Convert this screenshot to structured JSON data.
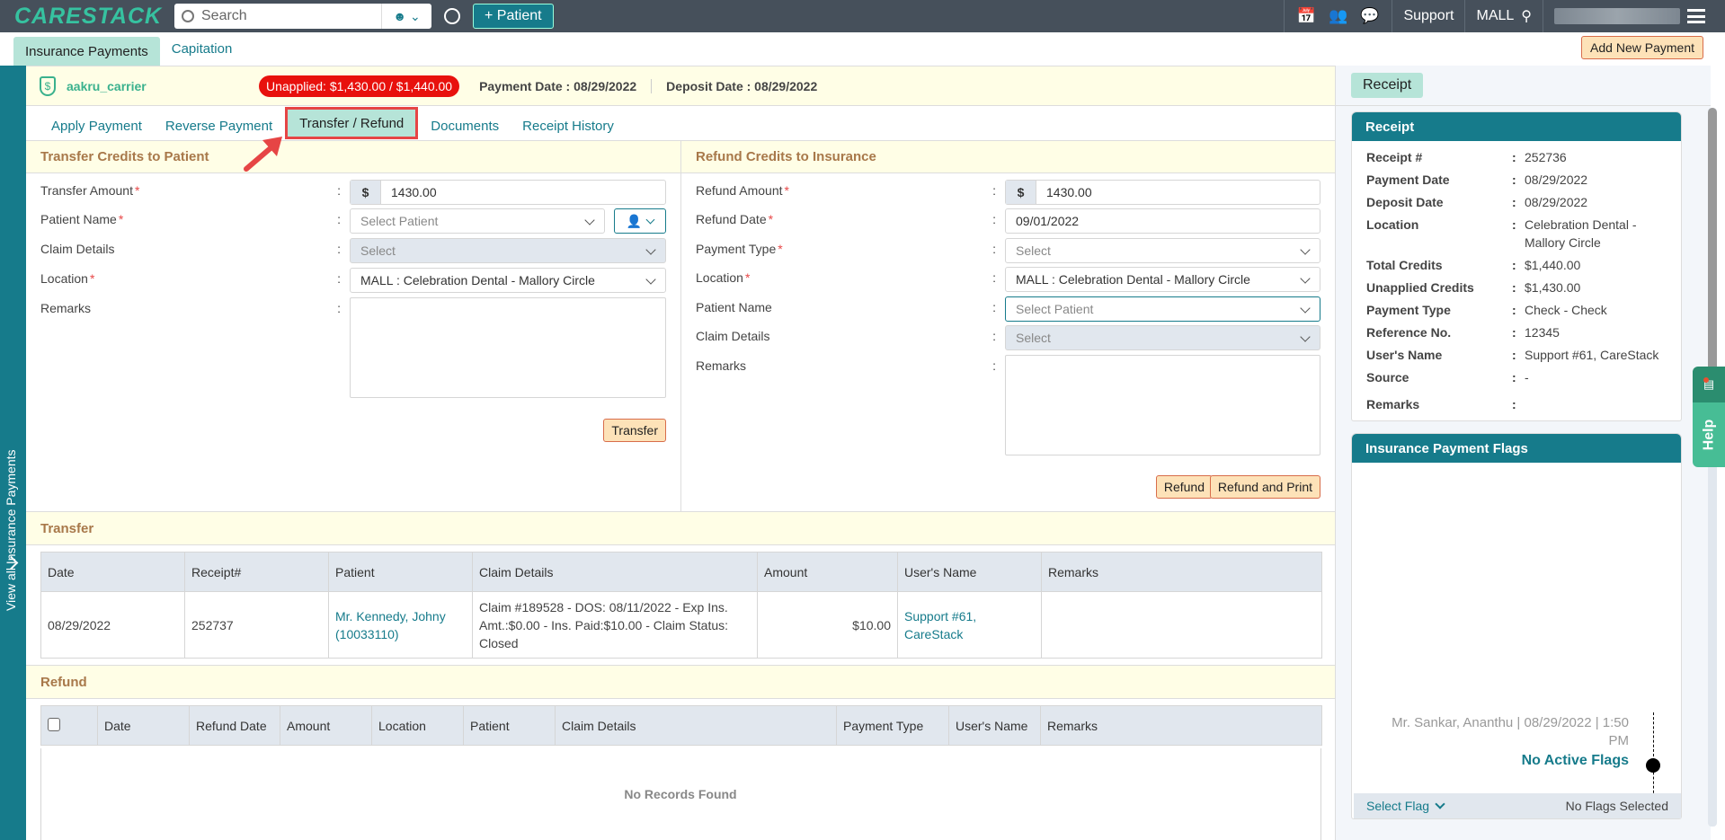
{
  "topbar": {
    "logo": "CARESTACK",
    "search_placeholder": "Search",
    "add_patient_label": "+ Patient",
    "support_label": "Support",
    "location_label": "MALL"
  },
  "subnav": {
    "tabs": [
      {
        "label": "Insurance Payments",
        "active": true
      },
      {
        "label": "Capitation",
        "active": false
      }
    ],
    "add_new_payment_label": "Add New Payment"
  },
  "sidebar": {
    "view_all_label": "View all Insurance Payments"
  },
  "payment_header": {
    "carrier": "aakru_carrier",
    "unapplied_badge": "Unapplied: $1,430.00 / $1,440.00",
    "payment_date": "Payment Date : 08/29/2022",
    "deposit_date": "Deposit Date : 08/29/2022"
  },
  "tabs": [
    {
      "label": "Apply Payment",
      "active": false
    },
    {
      "label": "Reverse Payment",
      "active": false
    },
    {
      "label": "Transfer / Refund",
      "active": true
    },
    {
      "label": "Documents",
      "active": false
    },
    {
      "label": "Receipt History",
      "active": false
    }
  ],
  "transfer_form": {
    "title": "Transfer Credits to Patient",
    "transfer_amount_label": "Transfer Amount",
    "currency_symbol": "$",
    "transfer_amount_value": "1430.00",
    "patient_name_label": "Patient Name",
    "patient_placeholder": "Select Patient",
    "claim_details_label": "Claim Details",
    "claim_placeholder": "Select",
    "location_label": "Location",
    "location_value": "MALL : Celebration Dental - Mallory Circle",
    "remarks_label": "Remarks",
    "remarks_value": "",
    "transfer_button": "Transfer"
  },
  "refund_form": {
    "title": "Refund Credits to Insurance",
    "refund_amount_label": "Refund Amount",
    "currency_symbol": "$",
    "refund_amount_value": "1430.00",
    "refund_date_label": "Refund Date",
    "refund_date_value": "09/01/2022",
    "payment_type_label": "Payment Type",
    "payment_type_placeholder": "Select",
    "location_label": "Location",
    "location_value": "MALL : Celebration Dental - Mallory Circle",
    "patient_name_label": "Patient Name",
    "patient_placeholder": "Select Patient",
    "claim_details_label": "Claim Details",
    "claim_placeholder": "Select",
    "remarks_label": "Remarks",
    "remarks_value": "",
    "refund_button": "Refund",
    "refund_print_button": "Refund and Print"
  },
  "transfer_table": {
    "title": "Transfer",
    "columns": [
      "Date",
      "Receipt#",
      "Patient",
      "Claim Details",
      "Amount",
      "User's Name",
      "Remarks"
    ],
    "rows": [
      {
        "date": "08/29/2022",
        "receipt": "252737",
        "patient": "Mr. Kennedy, Johny (10033110)",
        "claim_details": "Claim #189528 - DOS: 08/11/2022 - Exp Ins. Amt.:$0.00 - Ins. Paid:$10.00 - Claim Status: Closed",
        "amount": "$10.00",
        "user_name": "Support #61, CareStack",
        "remarks": ""
      }
    ]
  },
  "refund_table": {
    "title": "Refund",
    "columns": [
      "Date",
      "Refund Date",
      "Amount",
      "Location",
      "Patient",
      "Claim Details",
      "Payment Type",
      "User's Name",
      "Remarks"
    ],
    "rows": [],
    "empty_text": "No Records Found"
  },
  "receipt_panel": {
    "chip_label": "Receipt",
    "card_title": "Receipt",
    "fields": [
      {
        "label": "Receipt #",
        "value": "252736"
      },
      {
        "label": "Payment Date",
        "value": "08/29/2022"
      },
      {
        "label": "Deposit Date",
        "value": "08/29/2022"
      },
      {
        "label": "Location",
        "value": "Celebration Dental - Mallory Circle"
      },
      {
        "label": "Total Credits",
        "value": "$1,440.00"
      },
      {
        "label": "Unapplied Credits",
        "value": "$1,430.00"
      },
      {
        "label": "Payment Type",
        "value": "Check - Check"
      },
      {
        "label": "Reference No.",
        "value": "12345"
      },
      {
        "label": "User's Name",
        "value": "Support #61, CareStack"
      },
      {
        "label": "Source",
        "value": "-"
      },
      {
        "label": "Remarks",
        "value": ""
      }
    ]
  },
  "flags_panel": {
    "title": "Insurance Payment Flags",
    "entry_meta": "Mr. Sankar, Ananthu | 08/29/2022 | 1:50 PM",
    "entry_status": "No Active Flags",
    "select_flag_label": "Select Flag",
    "selected_text": "No Flags Selected"
  },
  "help_tab": {
    "label": "Help"
  },
  "colors": {
    "brand_teal": "#167b8b",
    "accent_green": "#36c2a0",
    "unapplied_red": "#e8110d",
    "section_bg": "#fffee6",
    "button_orange": "#fde2b8"
  }
}
